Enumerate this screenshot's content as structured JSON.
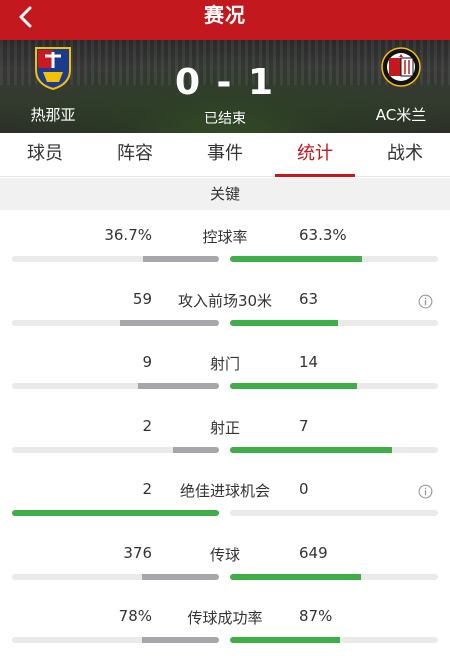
{
  "header": {
    "title": "赛况"
  },
  "match": {
    "home": {
      "name": "热那亚"
    },
    "away": {
      "name": "AC米兰"
    },
    "score": "0 - 1",
    "status": "已结束"
  },
  "tabs": [
    {
      "label": "球员"
    },
    {
      "label": "阵容"
    },
    {
      "label": "事件"
    },
    {
      "label": "统计",
      "active": true
    },
    {
      "label": "战术"
    }
  ],
  "section": {
    "title": "关键"
  },
  "stats": [
    {
      "name": "控球率",
      "left": "36.7%",
      "right": "63.3%",
      "left_share": 0.367,
      "right_share": 0.633,
      "info": false
    },
    {
      "name": "攻入前场30米",
      "left": "59",
      "right": "63",
      "left_share": 0.48,
      "right_share": 0.52,
      "info": true
    },
    {
      "name": "射门",
      "left": "9",
      "right": "14",
      "left_share": 0.39,
      "right_share": 0.61,
      "info": false
    },
    {
      "name": "射正",
      "left": "2",
      "right": "7",
      "left_share": 0.22,
      "right_share": 0.78,
      "info": false
    },
    {
      "name": "绝佳进球机会",
      "left": "2",
      "right": "0",
      "left_share": 1.0,
      "right_share": 0.0,
      "info": true,
      "left_leads": true
    },
    {
      "name": "传球",
      "left": "376",
      "right": "649",
      "left_share": 0.37,
      "right_share": 0.63,
      "info": false
    },
    {
      "name": "传球成功率",
      "left": "78%",
      "right": "87%",
      "left_share": 0.37,
      "right_share": 0.53,
      "info": false
    }
  ],
  "colors": {
    "brand": "#c3191e",
    "win": "#3fae49",
    "lose": "#a7a7ab"
  }
}
